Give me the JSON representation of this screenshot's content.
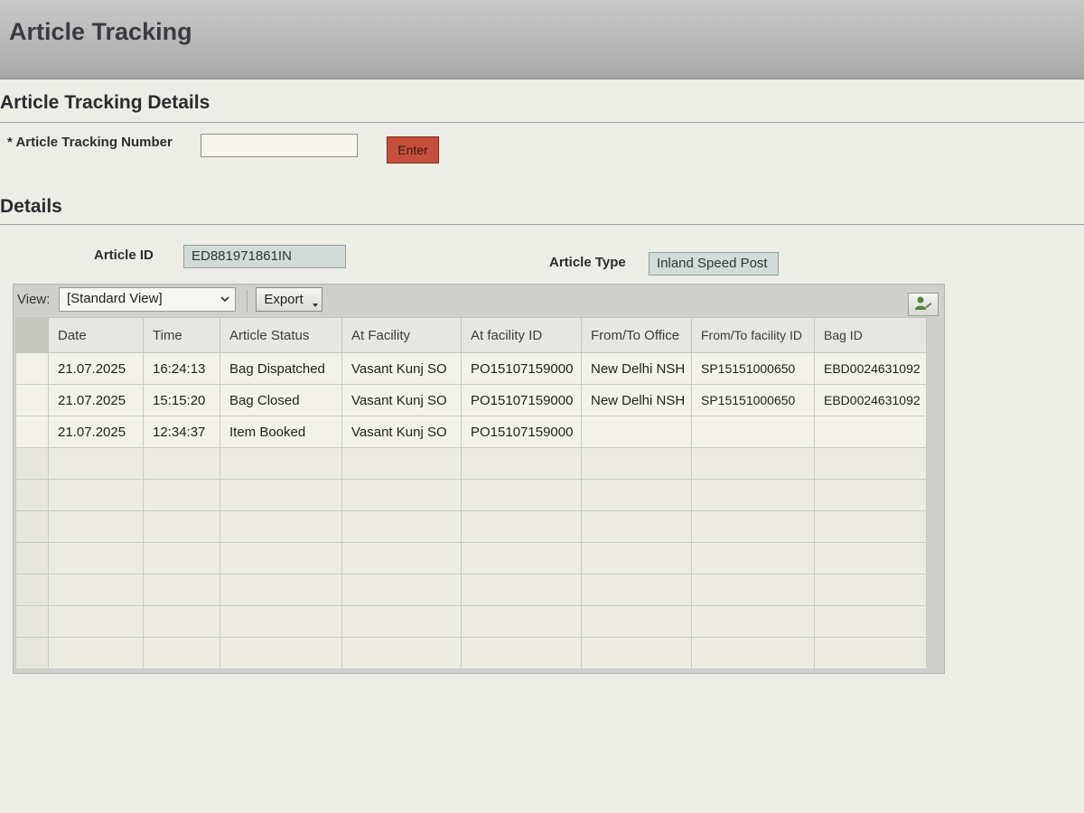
{
  "page": {
    "title": "Article Tracking"
  },
  "tracking_section": {
    "title": "Article Tracking Details",
    "field_label": "* Article Tracking Number",
    "input_value": "",
    "enter_label": "Enter"
  },
  "details_section": {
    "title": "Details",
    "article_id_label": "Article ID",
    "article_id_value": "ED881971861IN",
    "article_type_label": "Article Type",
    "article_type_value": "Inland Speed Post"
  },
  "toolbar": {
    "view_label": "View:",
    "view_selected": "[Standard View]",
    "export_label": "Export"
  },
  "table": {
    "columns": [
      "Date",
      "Time",
      "Article Status",
      "At Facility",
      "At facility ID",
      "From/To Office",
      "From/To facility ID",
      "Bag ID"
    ],
    "rows": [
      [
        "21.07.2025",
        "16:24:13",
        "Bag Dispatched",
        "Vasant Kunj SO",
        "PO15107159000",
        "New Delhi NSH",
        "SP15151000650",
        "EBD0024631092"
      ],
      [
        "21.07.2025",
        "15:15:20",
        "Bag Closed",
        "Vasant Kunj SO",
        "PO15107159000",
        "New Delhi NSH",
        "SP15151000650",
        "EBD0024631092"
      ],
      [
        "21.07.2025",
        "12:34:37",
        "Item Booked",
        "Vasant Kunj SO",
        "PO15107159000",
        "",
        "",
        ""
      ]
    ],
    "empty_row_count": 7
  },
  "icons": {
    "view_dropdown": "chevron-down-icon",
    "export_menu": "dropdown-triangle-icon",
    "settings": "user-settings-icon"
  },
  "colors": {
    "enter_button": "#c4503c",
    "settings_icon": "#4a8a3a"
  }
}
